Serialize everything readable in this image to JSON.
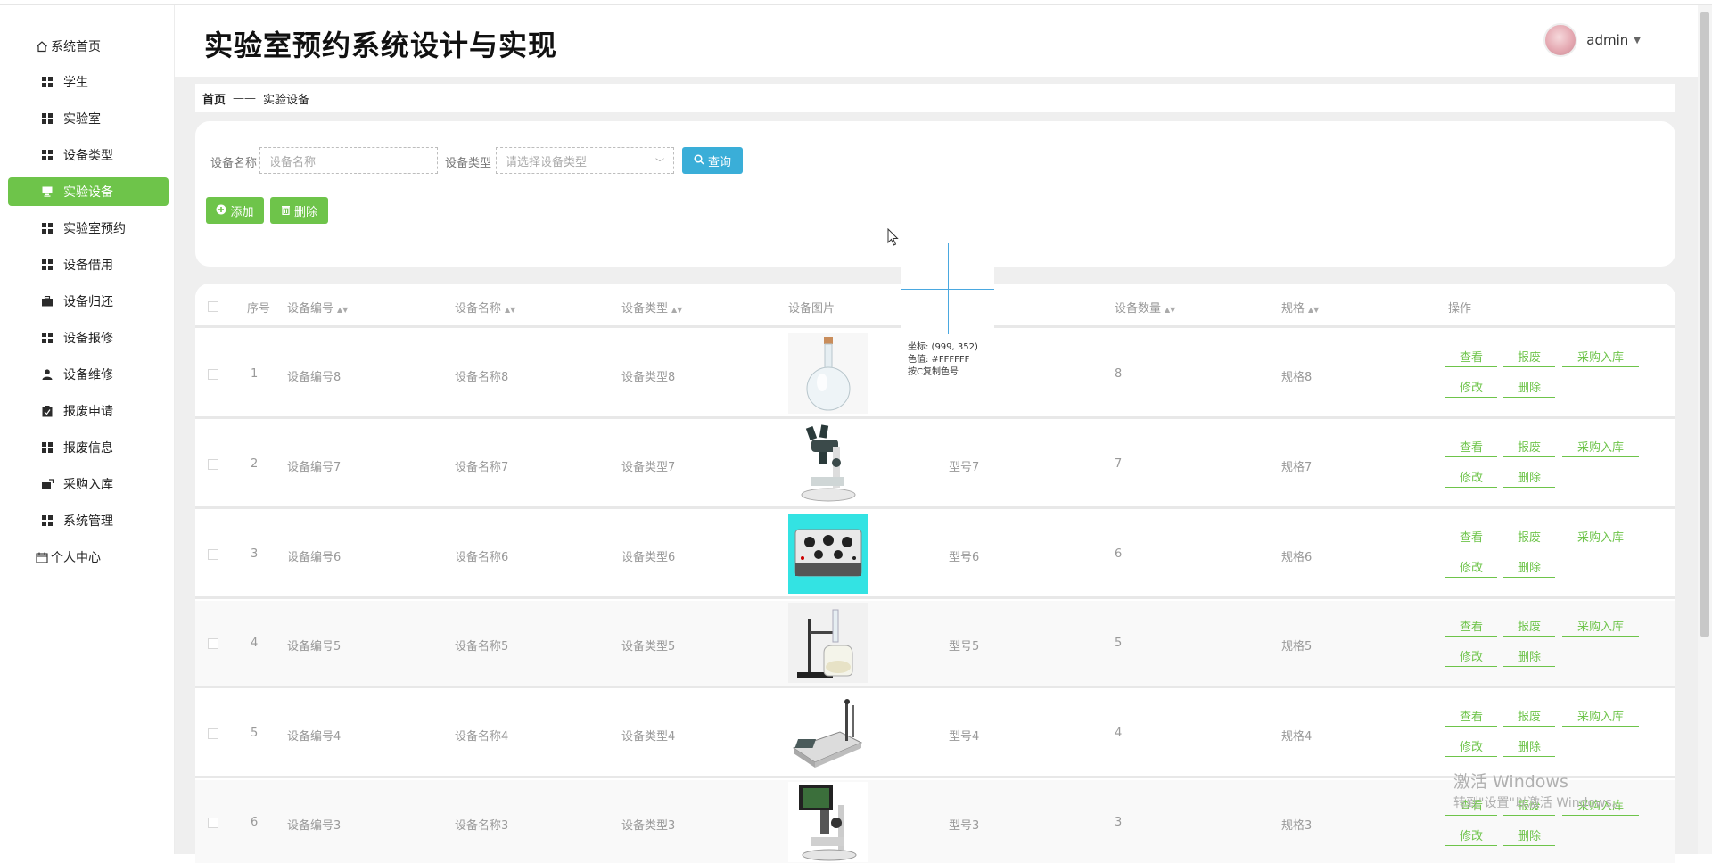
{
  "sidebar": {
    "items": [
      {
        "label": "系统首页",
        "icon": "home-icon"
      },
      {
        "label": "学生",
        "icon": "grid-icon"
      },
      {
        "label": "实验室",
        "icon": "grid-icon"
      },
      {
        "label": "设备类型",
        "icon": "grid-icon"
      },
      {
        "label": "实验设备",
        "icon": "monitor-icon",
        "active": true
      },
      {
        "label": "实验室预约",
        "icon": "grid-icon"
      },
      {
        "label": "设备借用",
        "icon": "grid-icon"
      },
      {
        "label": "设备归还",
        "icon": "briefcase-icon"
      },
      {
        "label": "设备报修",
        "icon": "grid-icon"
      },
      {
        "label": "设备维修",
        "icon": "user-icon"
      },
      {
        "label": "报废申请",
        "icon": "clipboard-icon"
      },
      {
        "label": "报废信息",
        "icon": "grid-icon"
      },
      {
        "label": "采购入库",
        "icon": "cart-icon"
      },
      {
        "label": "系统管理",
        "icon": "grid-icon"
      },
      {
        "label": "个人中心",
        "icon": "calendar-icon"
      }
    ]
  },
  "header": {
    "title": "实验室预约系统设计与实现",
    "username": "admin",
    "caret": "▼"
  },
  "breadcrumb": {
    "home": "首页",
    "sep": "——",
    "current": "实验设备"
  },
  "search": {
    "name_label": "设备名称",
    "name_placeholder": "设备名称",
    "type_label": "设备类型",
    "type_placeholder": "请选择设备类型",
    "query_button": "查询",
    "add_button": "添加",
    "delete_button": "删除"
  },
  "table": {
    "columns": {
      "index": "序号",
      "code": "设备编号",
      "name": "设备名称",
      "type": "设备类型",
      "image": "设备图片",
      "quantity": "设备数量",
      "spec": "规格",
      "actions": "操作"
    },
    "rows": [
      {
        "index": "1",
        "code": "设备编号8",
        "name": "设备名称8",
        "type": "设备类型8",
        "model": "",
        "quantity": "8",
        "spec": "规格8",
        "image": "round-flask"
      },
      {
        "index": "2",
        "code": "设备编号7",
        "name": "设备名称7",
        "type": "设备类型7",
        "model": "型号7",
        "quantity": "7",
        "spec": "规格7",
        "image": "microscope"
      },
      {
        "index": "3",
        "code": "设备编号6",
        "name": "设备名称6",
        "type": "设备类型6",
        "model": "型号6",
        "quantity": "6",
        "spec": "规格6",
        "image": "resistor-box"
      },
      {
        "index": "4",
        "code": "设备编号5",
        "name": "设备名称5",
        "type": "设备类型5",
        "model": "型号5",
        "quantity": "5",
        "spec": "规格5",
        "image": "stand-beaker"
      },
      {
        "index": "5",
        "code": "设备编号4",
        "name": "设备名称4",
        "type": "设备类型4",
        "model": "型号4",
        "quantity": "4",
        "spec": "规格4",
        "image": "ph-meter"
      },
      {
        "index": "6",
        "code": "设备编号3",
        "name": "设备名称3",
        "type": "设备类型3",
        "model": "型号3",
        "quantity": "3",
        "spec": "规格3",
        "image": "video-microscope"
      }
    ],
    "actions": {
      "view": "查看",
      "scrap": "报废",
      "purchase": "采购入库",
      "edit": "修改",
      "delete": "删除"
    }
  },
  "picker": {
    "coords": "坐标: (999, 352)",
    "color": "色值: #FFFFFF",
    "hint": "按C复制色号"
  },
  "watermark": {
    "line1": "激活 Windows",
    "line2": "转到\"设置\"以激活 Windows。"
  }
}
